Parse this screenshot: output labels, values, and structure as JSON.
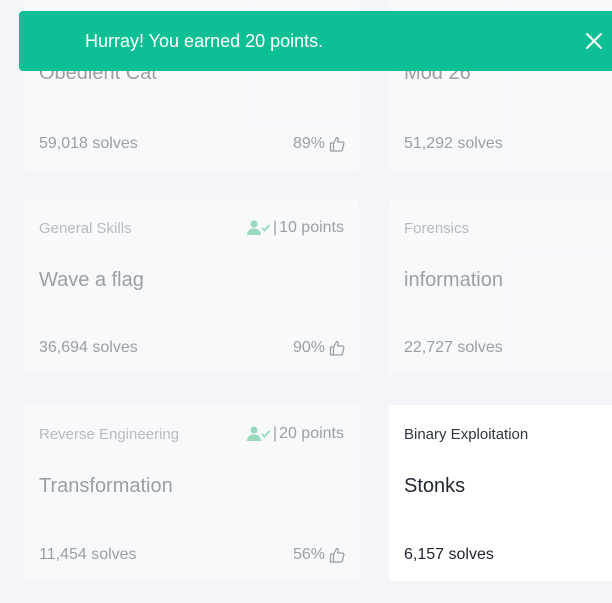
{
  "toast": {
    "message": "Hurray! You earned 20 points.",
    "close_icon": "close-icon",
    "color": "#0cbf94"
  },
  "cards": [
    {
      "category": "",
      "title": "Obedient Cat",
      "solves": "59,018 solves",
      "rating": "89%",
      "points": "",
      "solved": true
    },
    {
      "category": "",
      "title": "Mod 26",
      "solves": "51,292 solves",
      "rating": "",
      "points": "",
      "solved": true
    },
    {
      "category": "General Skills",
      "title": "Wave a flag",
      "solves": "36,694 solves",
      "rating": "90%",
      "points": "10 points",
      "solved": true
    },
    {
      "category": "Forensics",
      "title": "information",
      "solves": "22,727 solves",
      "rating": "",
      "points": "",
      "solved": true
    },
    {
      "category": "Reverse Engineering",
      "title": "Transformation",
      "solves": "11,454 solves",
      "rating": "56%",
      "points": "20 points",
      "solved": true
    },
    {
      "category": "Binary Exploitation",
      "title": "Stonks",
      "solves": "6,157 solves",
      "rating": "",
      "points": "",
      "solved": false
    }
  ],
  "colors": {
    "accent": "#0cbf94",
    "solved_icon": "#2ebd7d"
  }
}
